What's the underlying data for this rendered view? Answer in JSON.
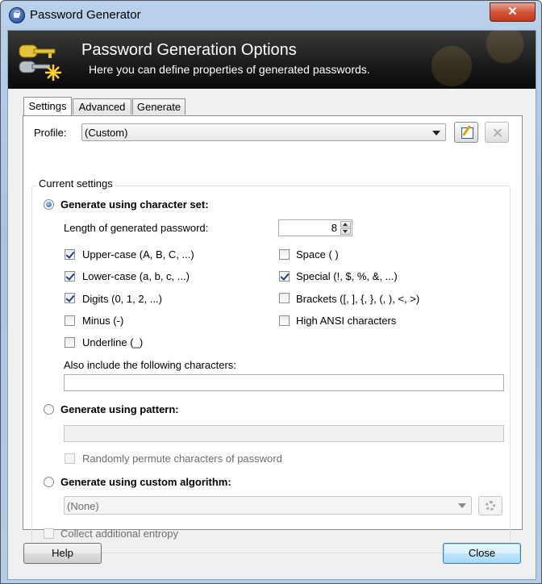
{
  "window": {
    "title": "Password Generator",
    "close_glyph": "✕"
  },
  "banner": {
    "title": "Password Generation Options",
    "subtitle": "Here you can define properties of generated passwords."
  },
  "tabs": [
    {
      "label": "Settings",
      "active": true
    },
    {
      "label": "Advanced",
      "active": false
    },
    {
      "label": "Generate",
      "active": false
    }
  ],
  "profile": {
    "label": "Profile:",
    "value": "(Custom)"
  },
  "current_settings": {
    "group_title": "Current settings",
    "charset_mode": {
      "label": "Generate using character set:",
      "selected": true
    },
    "length": {
      "label": "Length of generated password:",
      "value": "8"
    },
    "checkboxes_left": [
      {
        "label": "Upper-case (A, B, C, ...)",
        "checked": true
      },
      {
        "label": "Lower-case (a, b, c, ...)",
        "checked": true
      },
      {
        "label": "Digits (0, 1, 2, ...)",
        "checked": true
      },
      {
        "label": "Minus (-)",
        "checked": false
      },
      {
        "label": "Underline (_)",
        "checked": false
      }
    ],
    "checkboxes_right": [
      {
        "label": "Space ( )",
        "checked": false
      },
      {
        "label": "Special (!, $, %, &, ...)",
        "checked": true
      },
      {
        "label": "Brackets ([, ], {, }, (, ), <, >)",
        "checked": false
      },
      {
        "label": "High ANSI characters",
        "checked": false
      }
    ],
    "also_include": {
      "label": "Also include the following characters:",
      "value": ""
    },
    "pattern_mode": {
      "label": "Generate using pattern:",
      "selected": false,
      "value": ""
    },
    "permute": {
      "label": "Randomly permute characters of password",
      "checked": false
    },
    "custom_mode": {
      "label": "Generate using custom algorithm:",
      "selected": false,
      "value": "(None)"
    },
    "entropy": {
      "label": "Collect additional entropy",
      "checked": false
    }
  },
  "buttons": {
    "help": "Help",
    "close": "Close"
  },
  "icons": [
    "lock-icon",
    "keys-icon",
    "edit-profile-icon",
    "delete-profile-icon",
    "gear-icon"
  ],
  "colors": {
    "banner_bg": "#151515",
    "accent": "#0d5fb5",
    "close_red": "#c0391b"
  }
}
